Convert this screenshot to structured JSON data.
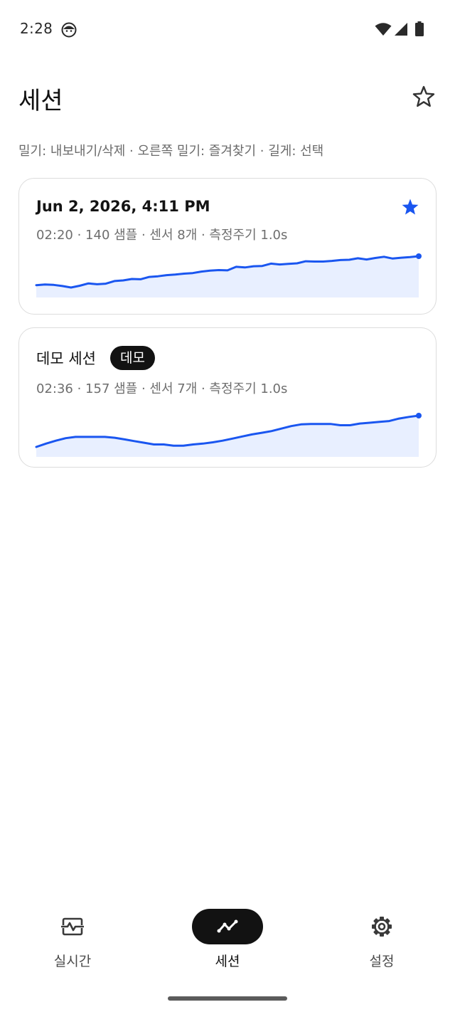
{
  "status_bar": {
    "time": "2:28"
  },
  "header": {
    "title": "세션",
    "hint": "밀기: 내보내기/삭제 · 오른쪽 밀기: 즐겨찾기 · 길게: 선택"
  },
  "sessions": [
    {
      "title": "Jun 2, 2026, 4:11 PM",
      "meta": "02:20 · 140 샘플 · 센서 8개 · 측정주기 1.0s",
      "favorite": true,
      "sparkline": [
        21,
        21.2,
        21.1,
        20.7,
        20.2,
        20.8,
        21.6,
        21.3,
        21.5,
        22.4,
        22.6,
        23.1,
        23.0,
        23.8,
        24.0,
        24.4,
        24.6,
        24.9,
        25.1,
        25.6,
        25.9,
        26.1,
        26.0,
        27.2,
        27.0,
        27.4,
        27.5,
        28.3,
        28.0,
        28.2,
        28.4,
        29.1,
        29.0,
        29.0,
        29.2,
        29.5,
        29.6,
        30.1,
        29.7,
        30.2,
        30.6,
        30.0,
        30.3,
        30.5,
        30.8
      ]
    },
    {
      "title": "데모 세션",
      "badge": "데모",
      "meta": "02:36 · 157 샘플 · 센서 7개 · 측정주기 1.0s",
      "favorite": false,
      "sparkline": [
        20,
        20.8,
        21.5,
        22.1,
        22.4,
        22.4,
        22.4,
        22.4,
        22.2,
        21.8,
        21.4,
        21.0,
        20.6,
        20.6,
        20.3,
        20.3,
        20.6,
        20.8,
        21.1,
        21.5,
        22.0,
        22.5,
        23.0,
        23.4,
        23.8,
        24.4,
        25.0,
        25.4,
        25.5,
        25.5,
        25.5,
        25.2,
        25.2,
        25.6,
        25.8,
        26.0,
        26.2,
        26.8,
        27.2,
        27.5
      ]
    }
  ],
  "bottom_nav": {
    "items": [
      {
        "label": "실시간",
        "icon": "realtime-icon"
      },
      {
        "label": "세션",
        "icon": "sessions-chart-icon",
        "selected": true
      },
      {
        "label": "설정",
        "icon": "settings-gear-icon"
      }
    ]
  },
  "colors": {
    "accent": "#1a56f0",
    "fill": "#e8efff",
    "selected_pill": "#121212"
  }
}
